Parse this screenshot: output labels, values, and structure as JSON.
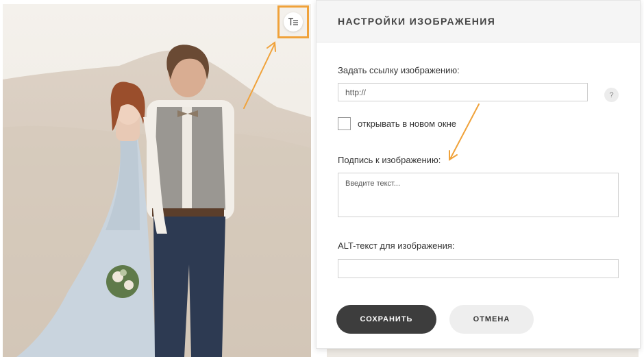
{
  "panel": {
    "title": "НАСТРОЙКИ ИЗОБРАЖЕНИЯ",
    "link_label": "Задать ссылку изображению:",
    "link_value": "http://",
    "help_symbol": "?",
    "new_window_label": "открывать в новом окне",
    "new_window_checked": false,
    "caption_label": "Подпись к изображению:",
    "caption_placeholder": "Введите текст...",
    "alt_label": "ALT-текст для изображения:",
    "alt_value": "",
    "save_label": "СОХРАНИТЬ",
    "cancel_label": "ОТМЕНА"
  },
  "photo": {
    "text_settings_icon": "text-align-icon"
  },
  "colors": {
    "highlight": "#f0a23a",
    "save_button": "#3d3d3d",
    "cancel_button": "#eeeeee"
  }
}
